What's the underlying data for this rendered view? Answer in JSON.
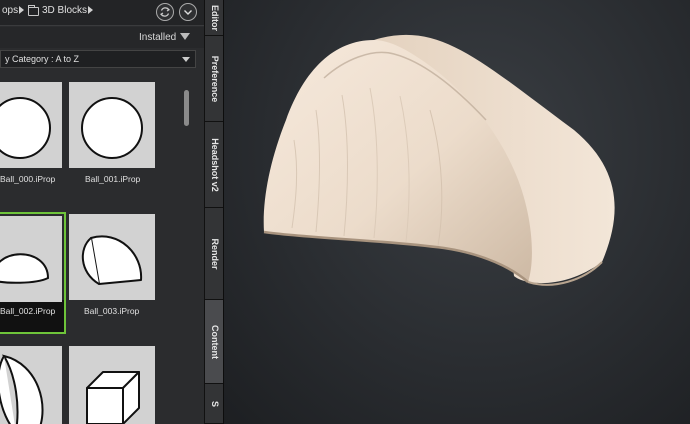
{
  "breadcrumb": {
    "parent": "ops",
    "current": "3D Blocks"
  },
  "filter": {
    "label": "Installed"
  },
  "sort": {
    "label": "y Category : A to Z"
  },
  "thumbnails": [
    {
      "label": "Ball_000.iProp",
      "shape": "circle"
    },
    {
      "label": "Ball_001.iProp",
      "shape": "circle"
    },
    {
      "label": "Ball_002.iProp",
      "shape": "dome",
      "selected": true
    },
    {
      "label": "Ball_003.iProp",
      "shape": "half-ball"
    },
    {
      "label": "",
      "shape": "quarter-ball"
    },
    {
      "label": "",
      "shape": "cube"
    }
  ],
  "side_tabs": [
    {
      "label": "Editor"
    },
    {
      "label": "Preference"
    },
    {
      "label": "Headshot v2"
    },
    {
      "label": "Render"
    },
    {
      "label": "Content",
      "active": true
    },
    {
      "label": "S"
    }
  ],
  "colors": {
    "selection": "#6ec43a",
    "model": "#ecdccb"
  },
  "icons": {
    "refresh": "refresh-icon",
    "collapse": "chevron-down-icon",
    "filter": "filter-icon",
    "folder": "folder-icon"
  }
}
